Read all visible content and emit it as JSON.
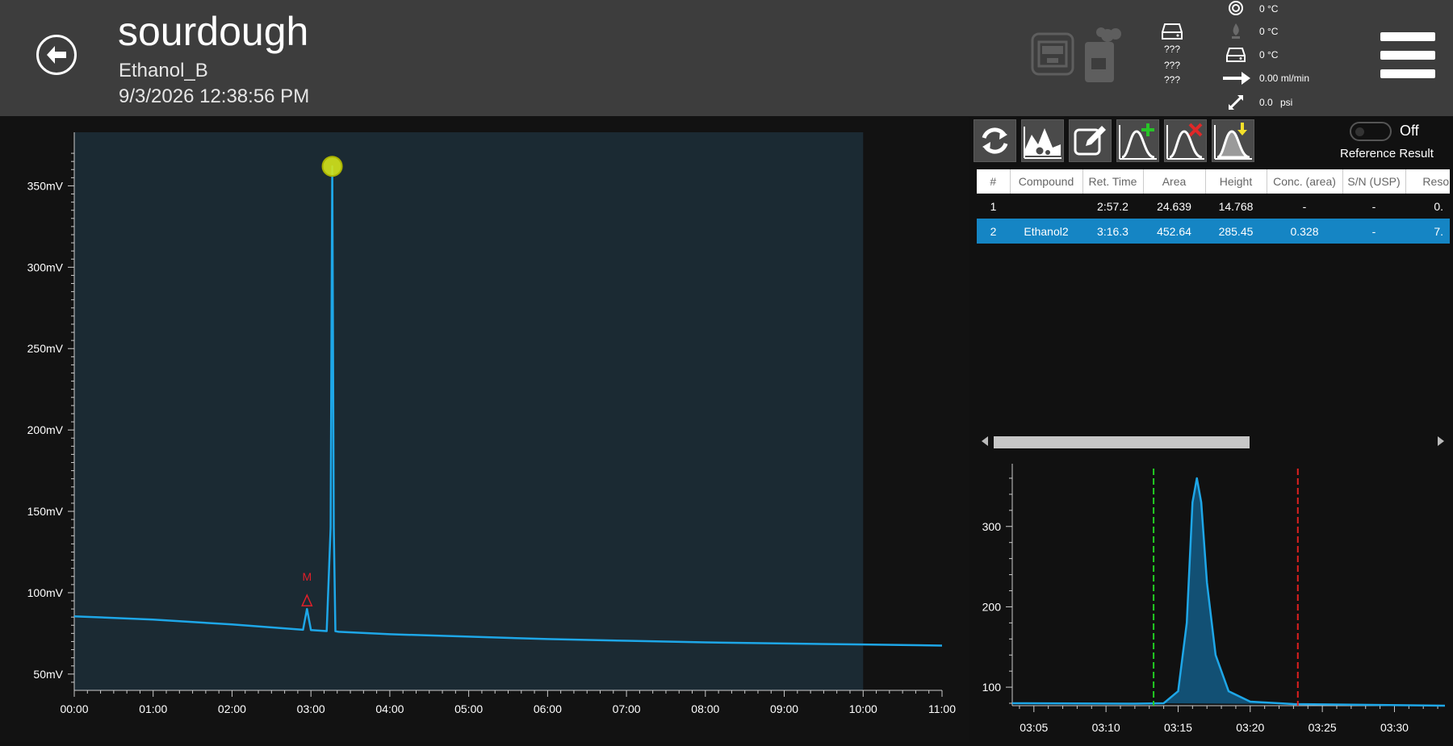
{
  "header": {
    "title": "sourdough",
    "method": "Ethanol_B",
    "timestamp": "9/3/2026 12:38:56 PM",
    "device_values": [
      "???",
      "???",
      "???"
    ],
    "status": {
      "oven_temp": "0 °C",
      "injector_temp": "0 °C",
      "detector_temp": "0 °C",
      "flow": "0.00 ml/min",
      "pressure_value": "0.0",
      "pressure_unit": "psi"
    }
  },
  "toolbar": {
    "buttons": [
      "refresh-icon",
      "integration-settings-icon",
      "edit-icon",
      "add-peak-icon",
      "delete-peak-icon",
      "reference-peak-icon"
    ],
    "toggle_state": "Off",
    "reference_label": "Reference Result"
  },
  "results_table": {
    "columns": [
      "#",
      "Compound",
      "Ret. Time",
      "Area",
      "Height",
      "Conc. (area)",
      "S/N (USP)",
      "Resolution"
    ],
    "rows": [
      {
        "num": "1",
        "compound": "",
        "ret_time": "2:57.2",
        "area": "24.639",
        "height": "14.768",
        "conc": "-",
        "sn": "-",
        "res": "0."
      },
      {
        "num": "2",
        "compound": "Ethanol2",
        "ret_time": "3:16.3",
        "area": "452.64",
        "height": "285.45",
        "conc": "0.328",
        "sn": "-",
        "res": "7."
      }
    ],
    "selected_row": 1
  },
  "colors": {
    "header_bg": "#3d3d3d",
    "trace": "#1ea7e8",
    "selected_row": "#1585c4",
    "peak_marker": "#d4e41b",
    "manual_marker": "#e0202a",
    "start_line": "#22cc22",
    "end_line": "#e02020"
  },
  "chart_data": [
    {
      "type": "line",
      "title": "",
      "xlabel": "",
      "ylabel": "",
      "x_ticks": [
        "00:00",
        "01:00",
        "02:00",
        "03:00",
        "04:00",
        "05:00",
        "06:00",
        "07:00",
        "08:00",
        "09:00",
        "10:00",
        "11:00"
      ],
      "y_ticks": [
        "50mV",
        "100mV",
        "150mV",
        "200mV",
        "250mV",
        "300mV",
        "350mV"
      ],
      "xlim_min": [
        0,
        11
      ],
      "ylim_mv": [
        40,
        375
      ],
      "shaded_region_min": [
        0,
        10
      ],
      "grid": false,
      "series": [
        {
          "x_min": [
            0,
            1,
            2,
            2.9,
            2.95,
            3.0,
            3.2,
            3.25,
            3.27,
            3.29,
            3.31,
            3.35,
            4,
            5,
            6,
            7,
            8,
            9,
            10,
            11
          ],
          "y_mv": [
            85.5,
            83.5,
            80.5,
            77.2,
            90.0,
            77.0,
            76.4,
            140,
            362,
            140,
            76.3,
            76.0,
            74.5,
            73,
            71.5,
            70.5,
            69.5,
            68.8,
            68.2,
            67.5
          ]
        }
      ],
      "annotations": [
        {
          "label": "M",
          "x_min": 2.95,
          "kind": "manual-marker"
        },
        {
          "label": "",
          "x_min": 3.27,
          "kind": "selected-peak"
        }
      ]
    },
    {
      "type": "line",
      "title": "",
      "xlabel": "",
      "ylabel": "",
      "x_ticks": [
        "03:05",
        "03:10",
        "03:15",
        "03:20",
        "03:25",
        "03:30"
      ],
      "y_ticks": [
        "100",
        "200",
        "300"
      ],
      "xlim_sec": [
        183.5,
        213.5
      ],
      "ylim": [
        77,
        372
      ],
      "start_line_sec": 193.3,
      "end_line_sec": 203.3,
      "series": [
        {
          "x_sec": [
            183.5,
            192,
            194,
            195,
            195.6,
            196.0,
            196.3,
            196.6,
            197.0,
            197.6,
            198.5,
            200,
            203,
            213.5
          ],
          "y": [
            80,
            79.5,
            80,
            95,
            180,
            330,
            360,
            330,
            230,
            140,
            95,
            82,
            79,
            77
          ]
        }
      ]
    }
  ]
}
